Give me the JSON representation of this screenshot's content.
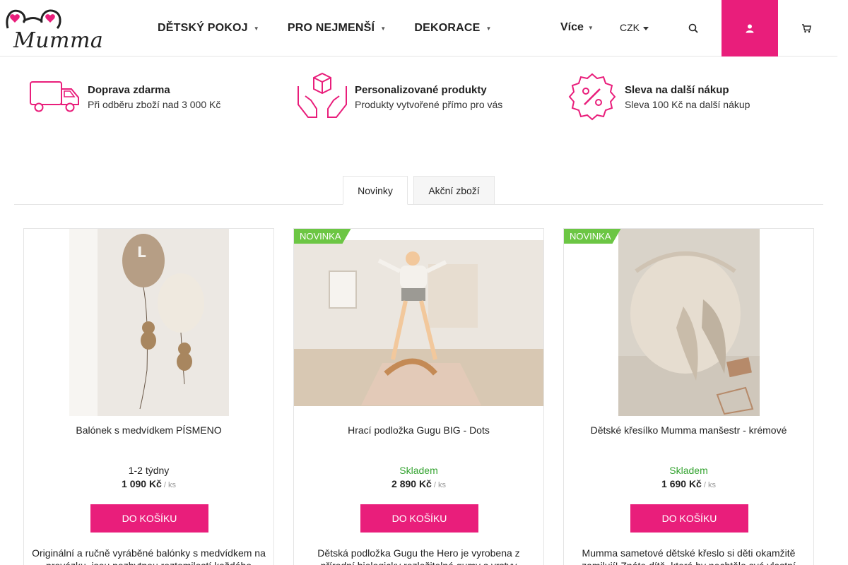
{
  "header": {
    "logo_text": "Mumma",
    "nav": [
      {
        "label": "DĚTSKÝ POKOJ"
      },
      {
        "label": "PRO NEJMENŠÍ"
      },
      {
        "label": "DEKORACE"
      }
    ],
    "more_label": "Více",
    "currency": "CZK",
    "icons": {
      "search": "search-icon",
      "user": "user-icon",
      "cart": "cart-icon"
    },
    "accent_color": "#e91e7b"
  },
  "benefits": [
    {
      "icon": "truck-icon",
      "title": "Doprava zdarma",
      "subtitle": "Při odběru zboží nad 3 000 Kč"
    },
    {
      "icon": "hands-box-icon",
      "title": "Personalizované produkty",
      "subtitle": "Produkty vytvořené přímo pro vás"
    },
    {
      "icon": "percent-badge-icon",
      "title": "Sleva na další nákup",
      "subtitle": "Sleva 100 Kč na další nákup"
    }
  ],
  "tabs": [
    {
      "label": "Novinky",
      "active": true
    },
    {
      "label": "Akční zboží",
      "active": false
    }
  ],
  "products": [
    {
      "flag": "",
      "name": "Balónek s medvídkem PÍSMENO",
      "availability": "1-2 týdny",
      "price": "1 090 Kč",
      "unit": "/ ks",
      "buy_label": "DO KOŠÍKU",
      "description": "Originální a ručně vyráběné balónky s medvídkem na provázku, jsou pozbytnou roztomilostí každého"
    },
    {
      "flag": "NOVINKA",
      "name": "Hrací podložka Gugu BIG - Dots",
      "availability": "Skladem",
      "price": "2 890 Kč",
      "unit": "/ ks",
      "buy_label": "DO KOŠÍKU",
      "description": "Dětská podložka Gugu the Hero je vyrobena z přírodní biologicky rozložitelné gumy s vrstvy"
    },
    {
      "flag": "NOVINKA",
      "name": "Dětské křesílko Mumma manšestr - krémové",
      "availability": "Skladem",
      "price": "1 690 Kč",
      "unit": "/ ks",
      "buy_label": "DO KOŠÍKU",
      "description": "Mumma sametové dětské křeslo si děti okamžitě zamilují! Znáte dítě, které by nechtělo své vlastní"
    }
  ]
}
